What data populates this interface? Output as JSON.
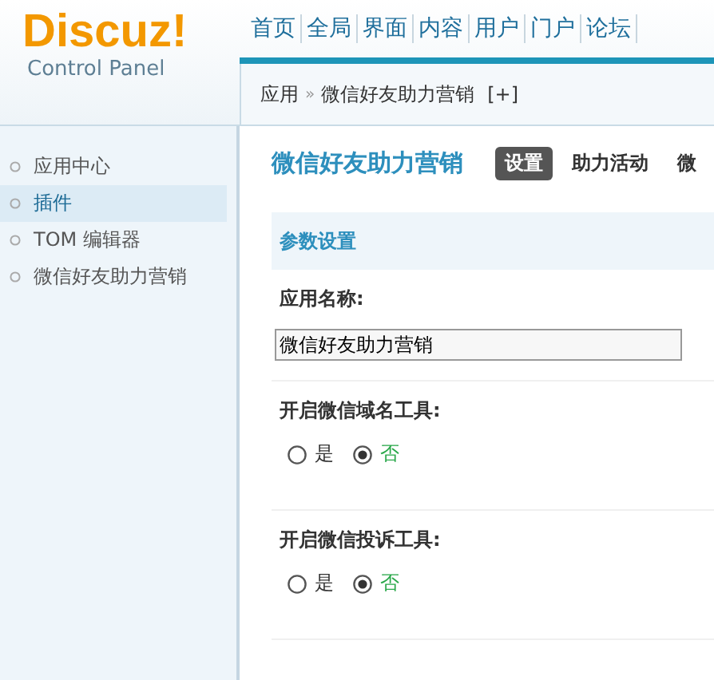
{
  "logo": {
    "name": "Discuz!",
    "subtitle": "Control Panel"
  },
  "nav": [
    {
      "label": "首页",
      "selected": false
    },
    {
      "label": "全局",
      "selected": false
    },
    {
      "label": "界面",
      "selected": false
    },
    {
      "label": "内容",
      "selected": false
    },
    {
      "label": "用户",
      "selected": false
    },
    {
      "label": "门户",
      "selected": false
    },
    {
      "label": "论坛",
      "selected": false
    }
  ],
  "breadcrumb": {
    "section": "应用",
    "separator": "»",
    "page": "微信好友助力营销",
    "add": "[+]"
  },
  "sidebar": {
    "items": [
      {
        "label": "应用中心",
        "selected": false
      },
      {
        "label": "插件",
        "selected": true
      },
      {
        "label": "TOM 编辑器",
        "selected": false
      },
      {
        "label": "微信好友助力营销",
        "selected": false
      }
    ]
  },
  "content": {
    "title": "微信好友助力营销",
    "tabs": [
      {
        "label": "设置",
        "selected": true
      },
      {
        "label": "助力活动",
        "selected": false
      },
      {
        "label": "微",
        "selected": false
      }
    ],
    "section": "参数设置",
    "fields": [
      {
        "kind": "text",
        "label": "应用名称:",
        "value": "微信好友助力营销"
      },
      {
        "kind": "radio",
        "label": "开启微信域名工具:",
        "options": [
          {
            "label": "是",
            "selected": false
          },
          {
            "label": "否",
            "selected": true
          }
        ]
      },
      {
        "kind": "radio",
        "label": "开启微信投诉工具:",
        "options": [
          {
            "label": "是",
            "selected": false
          },
          {
            "label": "否",
            "selected": true
          }
        ]
      }
    ]
  }
}
